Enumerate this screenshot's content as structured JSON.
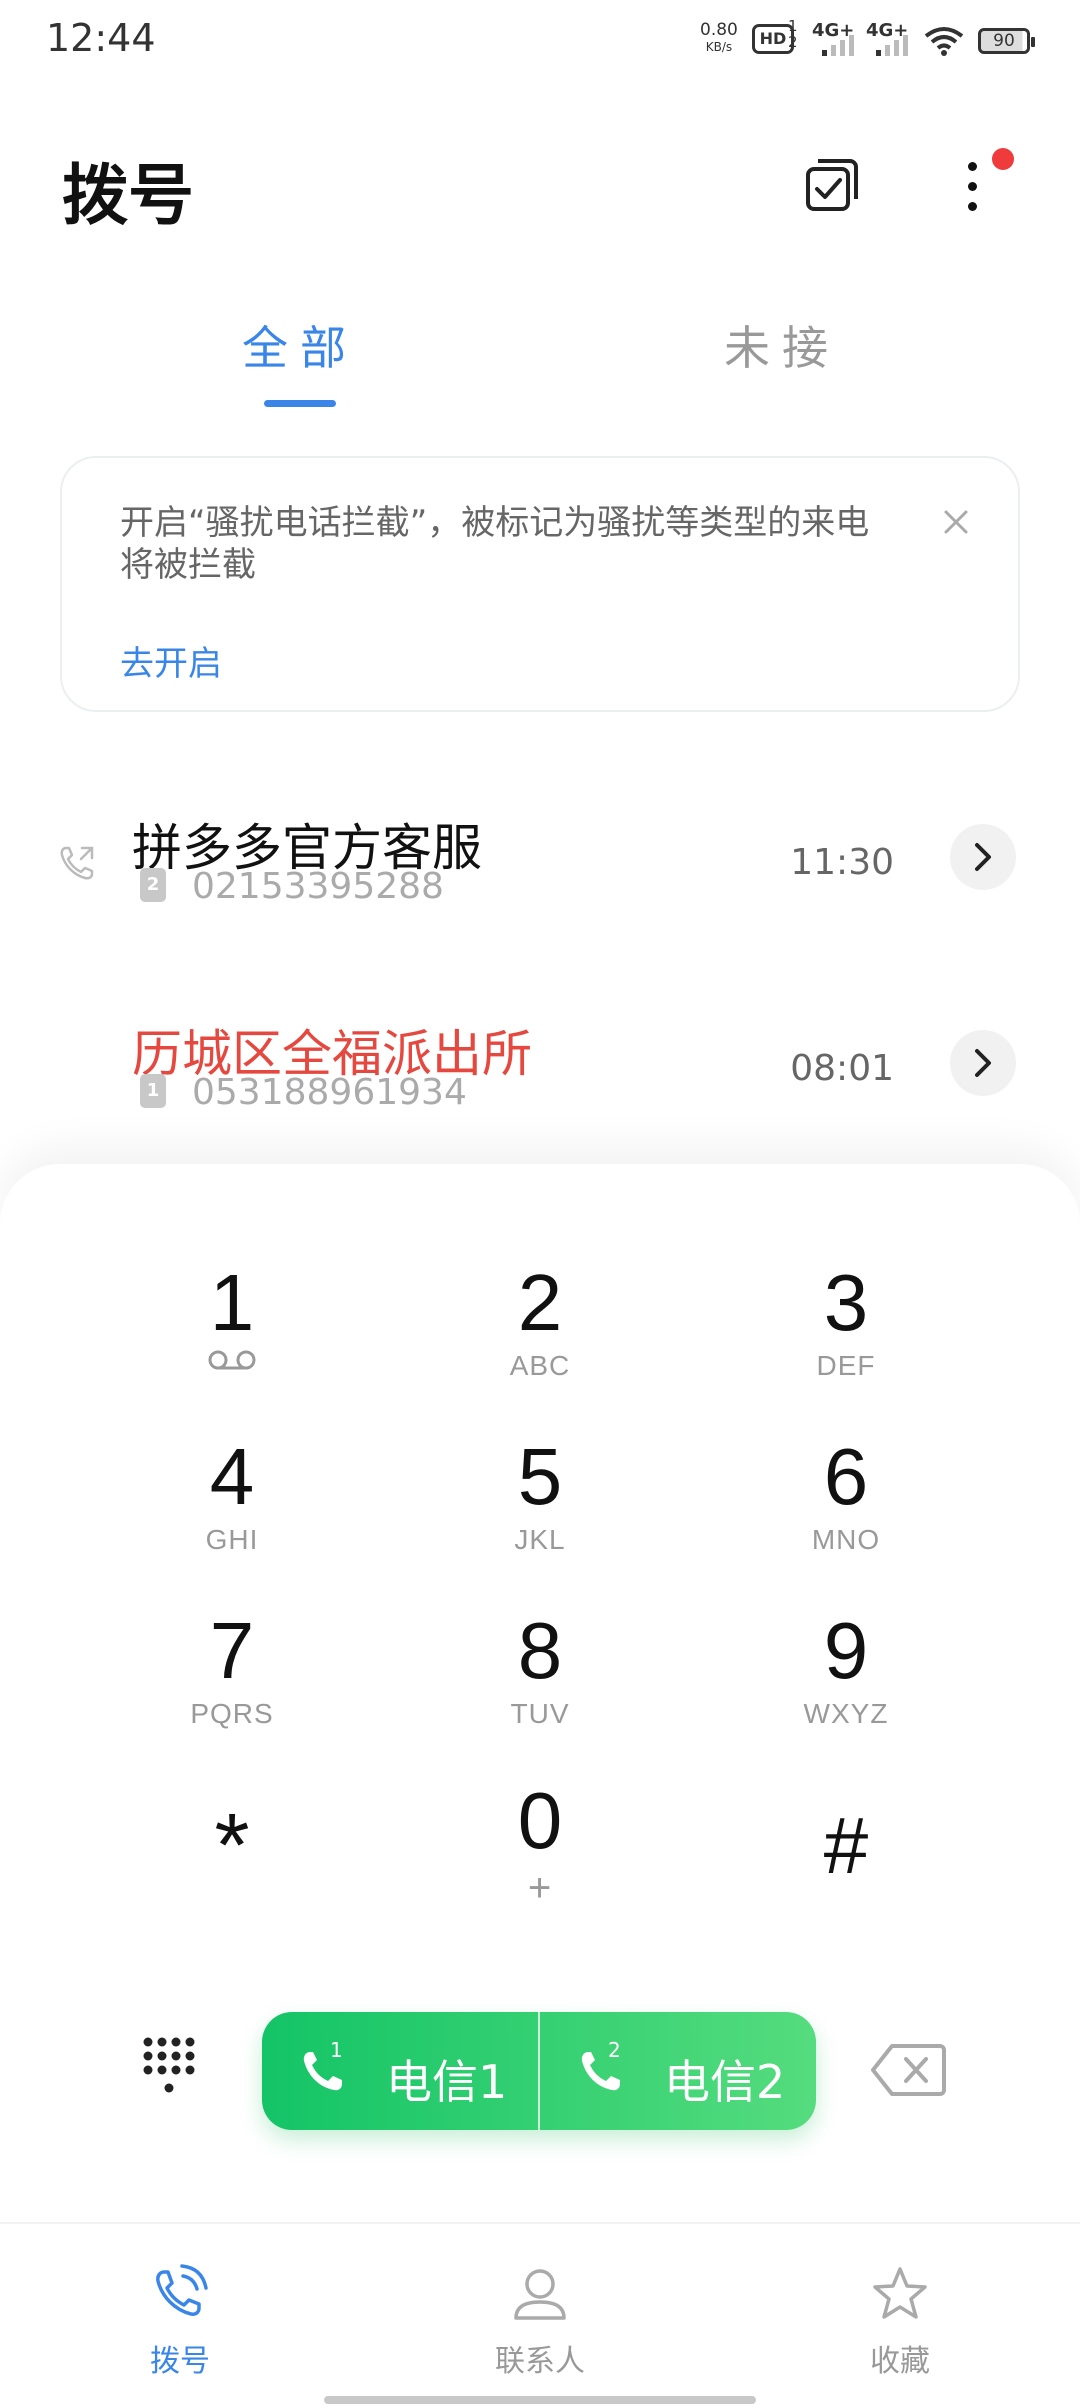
{
  "status_bar": {
    "time": "12:44",
    "net_speed_value": "0.80",
    "net_speed_unit": "KB/s",
    "hd": "HD",
    "hd_sims": "1 2",
    "signal1": "4G+",
    "signal2": "4G+",
    "battery": "90"
  },
  "header": {
    "title": "拨号",
    "icons": [
      "multi-select-icon",
      "more-icon"
    ]
  },
  "tabs": [
    {
      "label": "全部",
      "active": true
    },
    {
      "label": "未接",
      "active": false
    }
  ],
  "banner": {
    "text": "开启“骚扰电话拦截”，被标记为骚扰等类型的来电将被拦截",
    "action": "去开启"
  },
  "calls": [
    {
      "name": "拼多多官方客服",
      "sim": "2",
      "number": "02153395288",
      "time": "11:30",
      "missed": false
    },
    {
      "name": "历城区全福派出所",
      "sim": "1",
      "number": "053188961934",
      "time": "08:01",
      "missed": true
    }
  ],
  "dialpad": {
    "keys": [
      {
        "digit": "1",
        "letters": ""
      },
      {
        "digit": "2",
        "letters": "ABC"
      },
      {
        "digit": "3",
        "letters": "DEF"
      },
      {
        "digit": "4",
        "letters": "GHI"
      },
      {
        "digit": "5",
        "letters": "JKL"
      },
      {
        "digit": "6",
        "letters": "MNO"
      },
      {
        "digit": "7",
        "letters": "PQRS"
      },
      {
        "digit": "8",
        "letters": "TUV"
      },
      {
        "digit": "9",
        "letters": "WXYZ"
      },
      {
        "digit": "*",
        "letters": ""
      },
      {
        "digit": "0",
        "letters": "+"
      },
      {
        "digit": "#",
        "letters": ""
      }
    ]
  },
  "actions": {
    "sim1_sup": "1",
    "sim1_label": "电信1",
    "sim2_sup": "2",
    "sim2_label": "电信2"
  },
  "bottom_nav": [
    {
      "label": "拨号",
      "active": true
    },
    {
      "label": "联系人",
      "active": false
    },
    {
      "label": "收藏",
      "active": false
    }
  ],
  "colors": {
    "accent": "#3a86e8",
    "missed": "#e5483f",
    "call_green": "#13c466",
    "notification_dot": "#ef3b3b"
  }
}
